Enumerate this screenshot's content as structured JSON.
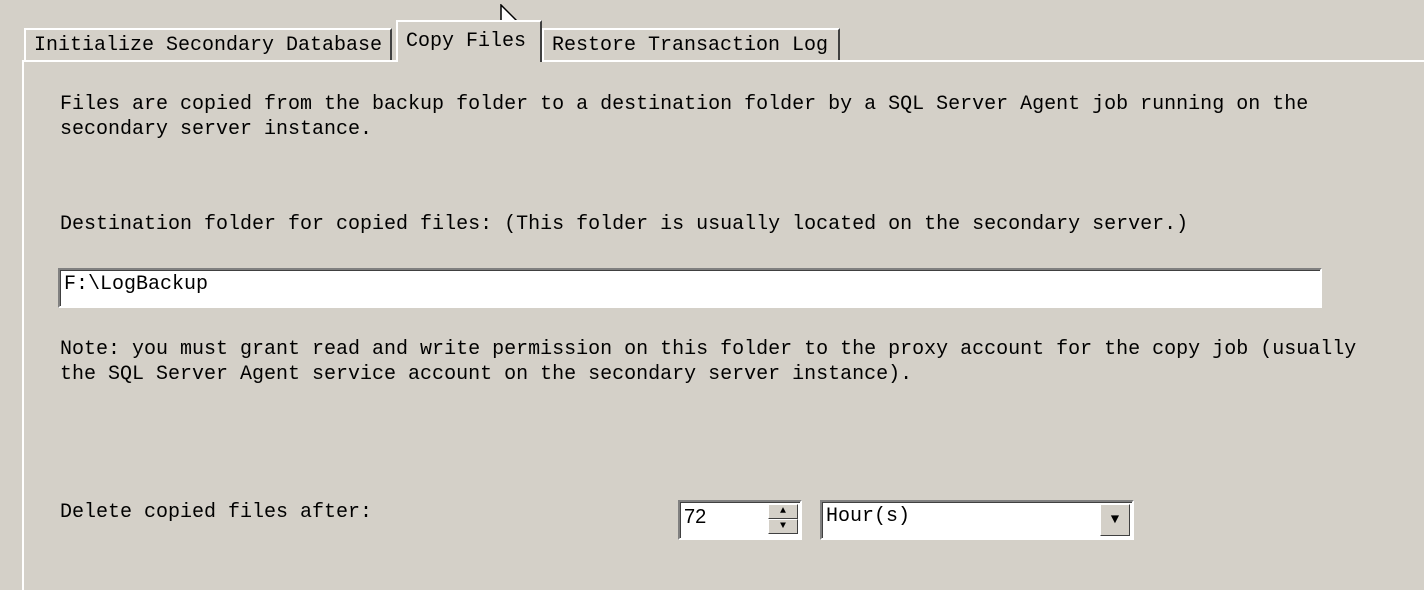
{
  "tabs": [
    {
      "label": "Initialize Secondary Database"
    },
    {
      "label": "Copy Files",
      "active": true
    },
    {
      "label": "Restore Transaction Log"
    }
  ],
  "description": "Files are copied from the backup folder to a destination folder by a SQL Server Agent job running on the\nsecondary server instance.",
  "destination_label": "Destination folder for copied files: (This folder is usually located on the secondary server.)",
  "destination_value": "F:\\LogBackup",
  "note": "Note: you must grant read and write permission on this folder to the proxy account for the copy job (usually\nthe SQL Server Agent service account on the secondary server instance).",
  "delete_label": "Delete copied files after:",
  "delete_value": "72",
  "delete_unit": "Hour(s)"
}
